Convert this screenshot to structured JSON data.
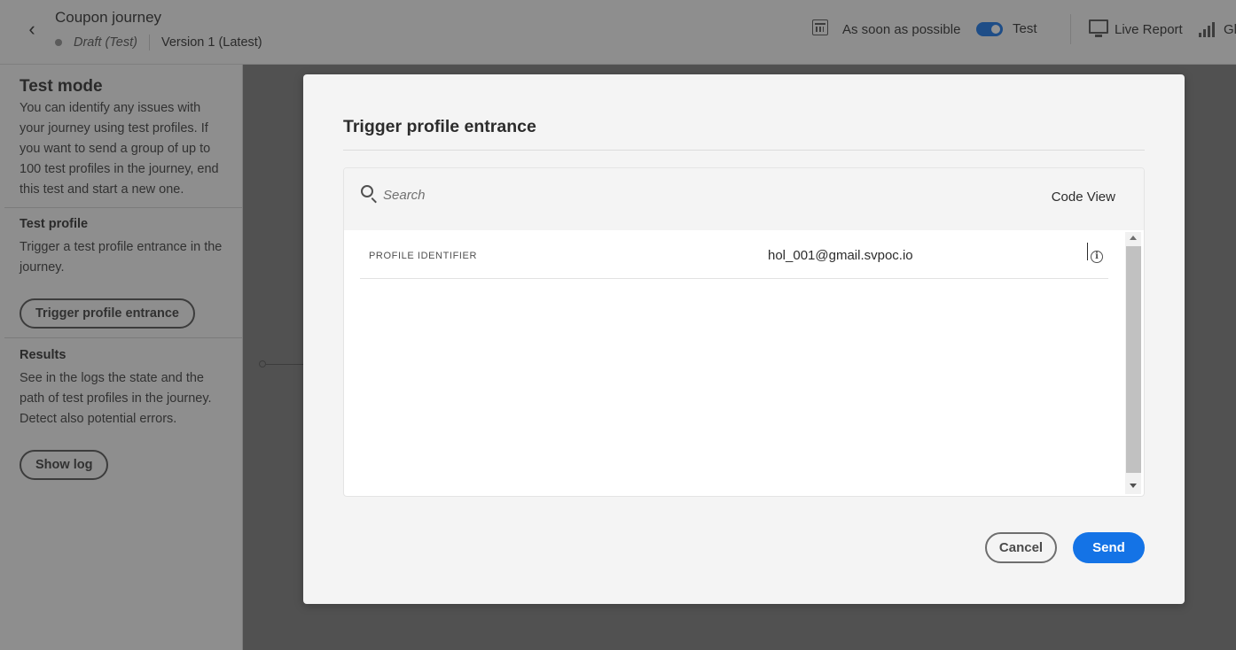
{
  "header": {
    "title": "Coupon journey",
    "status": "Draft (Test)",
    "version": "Version 1 (Latest)",
    "schedule_label": "As soon as possible",
    "test_toggle_label": "Test",
    "test_toggle_on": true,
    "live_report_label": "Live Report",
    "truncated_label": "Gl"
  },
  "left_panel": {
    "test_mode": {
      "heading": "Test mode",
      "text": "You can identify any issues with your journey using test profiles. If you want to send a group of up to 100 test profiles in the journey, end this test and start a new one."
    },
    "test_profile": {
      "heading": "Test profile",
      "text": "Trigger a test profile entrance in the journey.",
      "button": "Trigger profile entrance"
    },
    "results": {
      "heading": "Results",
      "text": "See in the logs the state and the path of test profiles in the journey. Detect also potential errors.",
      "button": "Show log"
    }
  },
  "dialog": {
    "title": "Trigger profile entrance",
    "search_placeholder": "Search",
    "code_view_label": "Code View",
    "fields": [
      {
        "key": "PROFILE IDENTIFIER",
        "value": "hol_001@gmail.svpoc.io"
      }
    ],
    "cancel_label": "Cancel",
    "send_label": "Send"
  },
  "colors": {
    "accent": "#1473e6",
    "overlay": "rgba(40,40,40,0.5)"
  },
  "icons": {
    "back": "chevron-left-icon",
    "calendar": "calendar-icon",
    "live_report": "monitor-pulse-icon",
    "global": "bar-chart-icon",
    "search": "search-icon",
    "info": "info-icon"
  }
}
